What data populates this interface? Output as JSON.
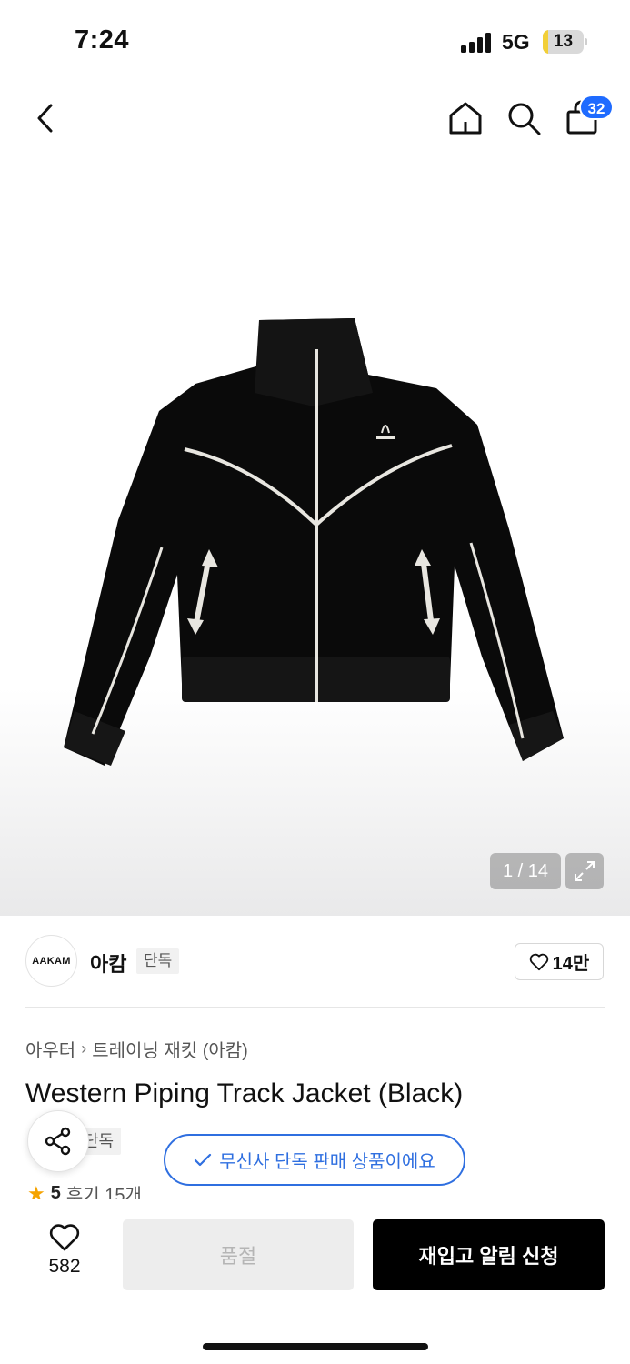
{
  "status_bar": {
    "time": "7:24",
    "network": "5G",
    "battery": "13",
    "battery_level": 0.13,
    "battery_color": "#f2cf38"
  },
  "nav": {
    "back_icon": "chevron-left-icon",
    "home_icon": "home-icon",
    "search_icon": "search-icon",
    "cart_icon": "shopping-bag-icon",
    "cart_badge": "32",
    "badge_color": "#1f6bff"
  },
  "product_image": {
    "counter": "1 / 14",
    "expand_icon": "expand-icon"
  },
  "brand": {
    "logo_text": "AAKAM",
    "name": "아캄",
    "tag": "단독",
    "likes": "14만"
  },
  "breadcrumb": {
    "category": "아우터",
    "subcategory": "트레이닝 재킷 (아캄)"
  },
  "product": {
    "title": "Western Piping Track Jacket (Black)",
    "exclusive_tag": "단독",
    "exclusive_notice": "무신사 단독 판매 상품이에요",
    "accent_color": "#2f6fe0",
    "rating": "5",
    "reviews": "후기 15개"
  },
  "bottom_bar": {
    "wish_count": "582",
    "soldout_label": "품절",
    "notify_label": "재입고 알림 신청"
  }
}
